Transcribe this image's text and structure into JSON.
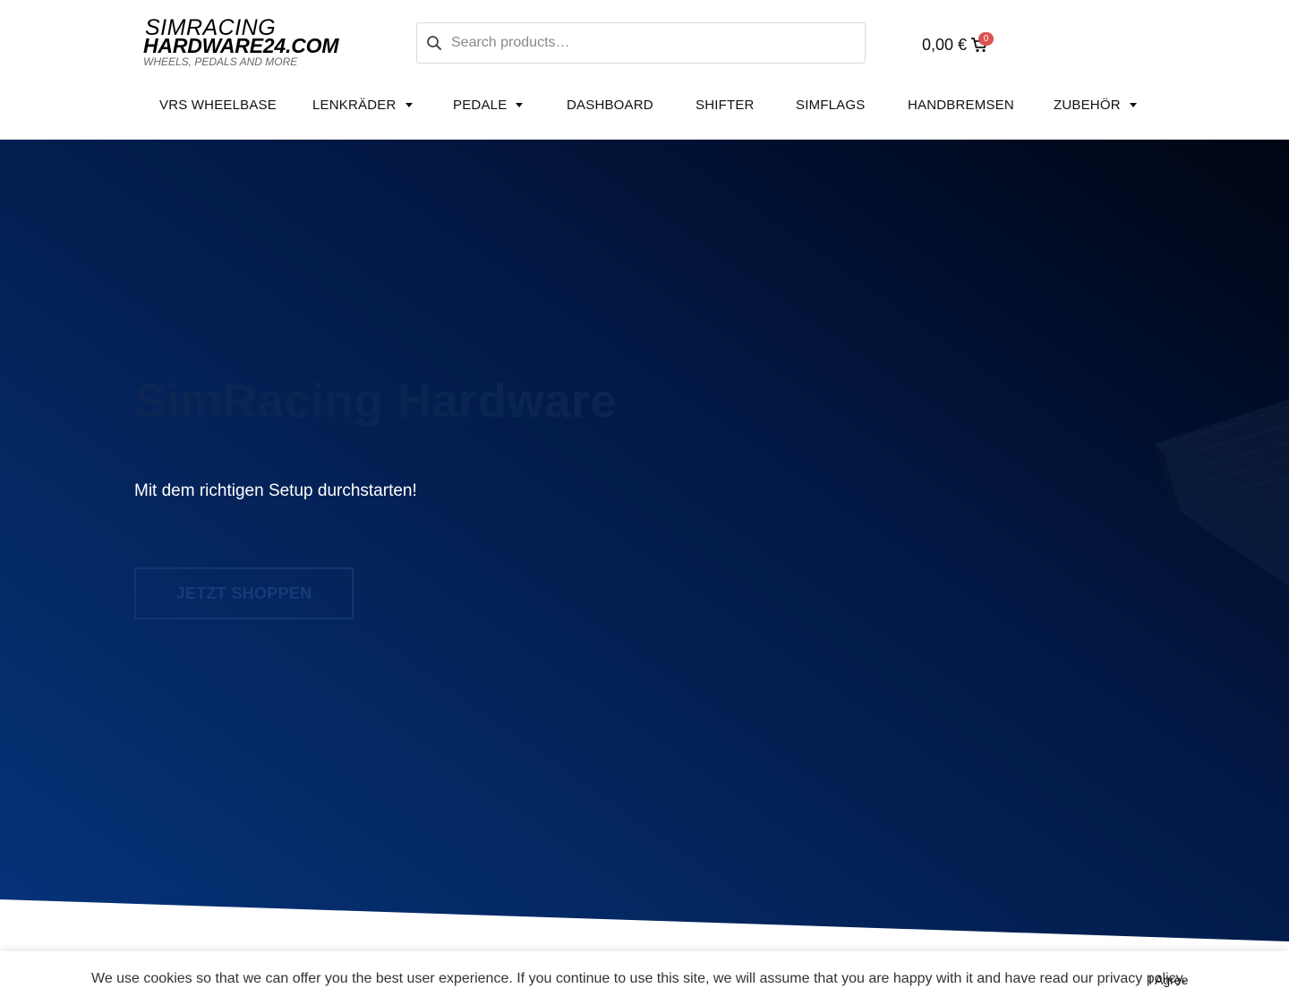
{
  "logo": {
    "line1": "SIMRACING",
    "line2": "HARDWARE24.COM",
    "line3": "WHEELS, PEDALS AND MORE"
  },
  "search": {
    "placeholder": "Search products…",
    "icon": "search-icon"
  },
  "cart": {
    "total": "0,00 €",
    "count": "0",
    "icon": "cart-icon",
    "badge_color": "#d9534f"
  },
  "nav": {
    "items": [
      {
        "label": "VRS WHEELBASE",
        "has_dropdown": false
      },
      {
        "label": "LENKRÄDER",
        "has_dropdown": true
      },
      {
        "label": "PEDALE",
        "has_dropdown": true
      },
      {
        "label": "DASHBOARD",
        "has_dropdown": false
      },
      {
        "label": "SHIFTER",
        "has_dropdown": false
      },
      {
        "label": "SIMFLAGS",
        "has_dropdown": false
      },
      {
        "label": "HANDBREMSEN",
        "has_dropdown": false
      },
      {
        "label": "ZUBEHÖR",
        "has_dropdown": true
      }
    ]
  },
  "hero": {
    "title": "SimRacing Hardware",
    "subtitle": "Mit dem richtigen Setup durchstarten!",
    "button": "JETZT SHOPPEN",
    "bg_color_start": "#06337a",
    "bg_color_end": "#000513"
  },
  "cookie": {
    "text": "We use cookies so that we can offer you the best user experience. If you continue to use this site, we will assume that you are happy with it and have read our privacy policy.",
    "agree": "I Agree"
  }
}
